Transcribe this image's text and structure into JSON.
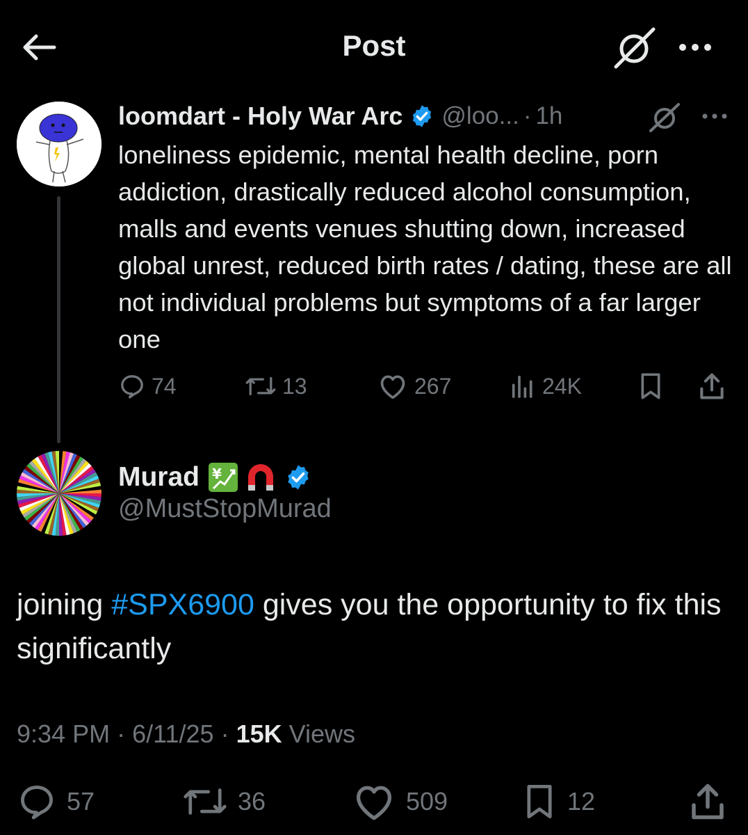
{
  "header": {
    "title": "Post"
  },
  "parent": {
    "display_name": "loomdart - Holy War Arc",
    "handle": "@loo...",
    "separator": "·",
    "time": "1h",
    "text": "loneliness epidemic, mental health decline, porn addiction, drastically reduced alcohol consumption, malls and events venues shutting down, increased global unrest, reduced birth rates / dating,  these are all not individual problems but symptoms of a far larger one",
    "actions": {
      "replies": "74",
      "reposts": "13",
      "likes": "267",
      "views": "24K"
    }
  },
  "main": {
    "display_name": "Murad",
    "name_emojis": [
      "chart-yen-emoji",
      "magnet-emoji"
    ],
    "handle": "@MustStopMurad",
    "text_before": "joining ",
    "hashtag": "#SPX6900",
    "text_after": " gives you the opportunity to fix this significantly",
    "time": "9:34 PM",
    "sep1": "·",
    "date": "6/11/25",
    "sep2": "·",
    "views_count": "15K",
    "views_label": "Views",
    "actions": {
      "replies": "57",
      "reposts": "36",
      "likes": "509",
      "bookmarks": "12"
    }
  },
  "colors": {
    "background": "#000000",
    "text": "#e7e9ea",
    "muted": "#71767b",
    "accent": "#1d9bf0",
    "verified": "#1d9bf0"
  }
}
